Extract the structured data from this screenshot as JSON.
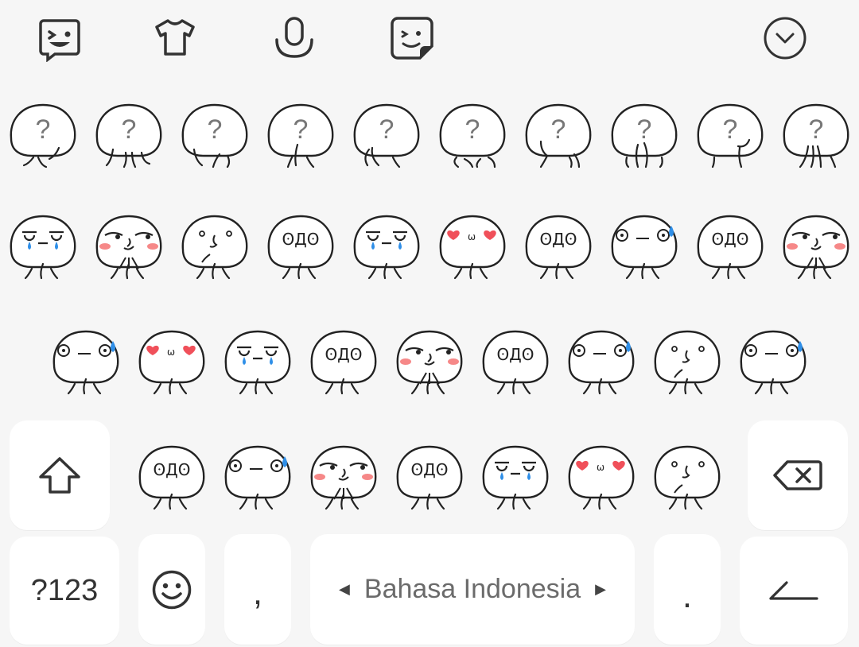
{
  "toolbar": {
    "icons": [
      "emoji-icon",
      "theme-icon",
      "microphone-icon",
      "sticker-icon",
      "collapse-icon"
    ]
  },
  "sticker_rows": [
    [
      "question-hands",
      "question-shrug",
      "question-point",
      "question-chin",
      "question-wave",
      "question-hands-low",
      "question-finger",
      "question-pray",
      "question-chin-right",
      "question-fingers"
    ],
    [
      "crying",
      "smirk-blush",
      "skeptical",
      "shocked",
      "crying",
      "hearts-love",
      "shocked",
      "sweat-nervous",
      "shocked",
      "smirk-blush"
    ],
    [
      "sweat-nervous",
      "hearts-love",
      "crying",
      "shocked",
      "smirk-blush",
      "shocked",
      "sweat-nervous",
      "skeptical",
      "sweat-nervous"
    ],
    [
      "shocked",
      "sweat-nervous",
      "smirk-blush",
      "shocked",
      "crying",
      "hearts-love",
      "skeptical"
    ]
  ],
  "keys": {
    "numbers_label": "?123",
    "comma_label": ",",
    "period_label": ".",
    "space_label": "Bahasa Indonesia"
  },
  "colors": {
    "background": "#f6f6f6",
    "key": "#ffffff",
    "blush": "#f46a6a",
    "tear": "#2f8fe8",
    "heart": "#f0505a"
  }
}
